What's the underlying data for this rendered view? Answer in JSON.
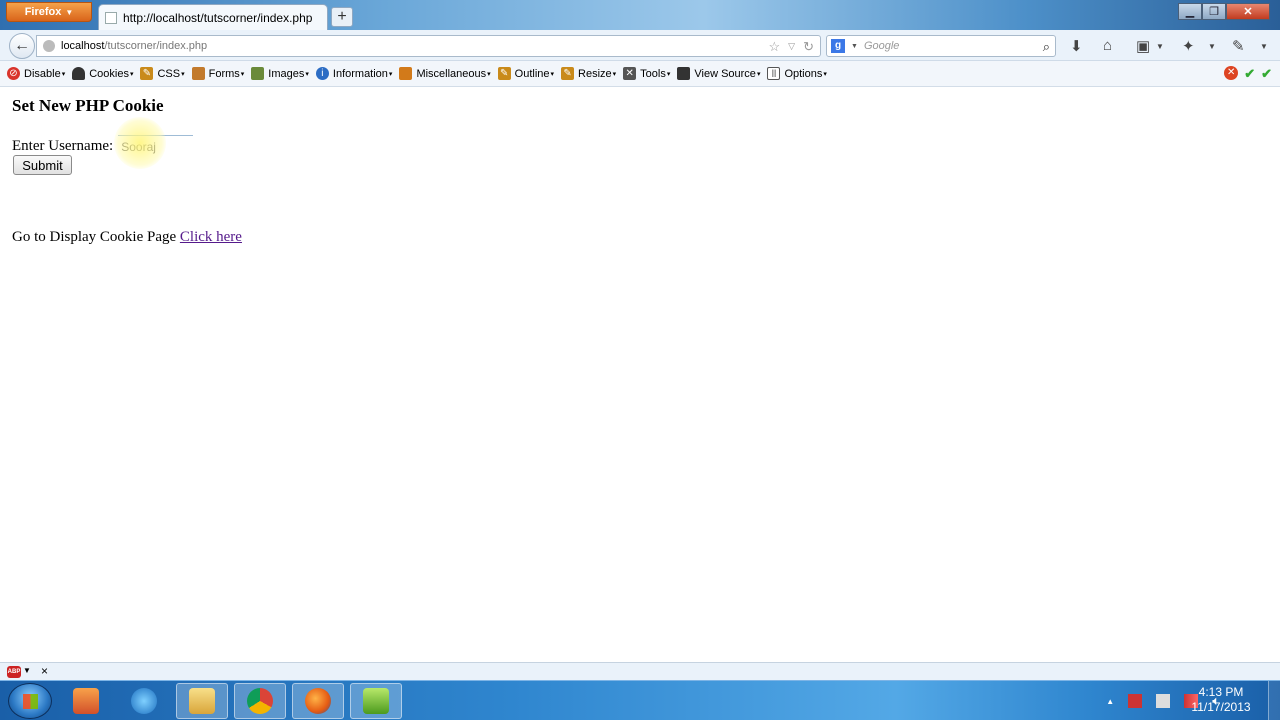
{
  "browser": {
    "app_button": "Firefox",
    "tab_title": "http://localhost/tutscorner/index.php",
    "new_tab": "+",
    "url_host": "localhost",
    "url_path": "/tutscorner/index.php",
    "search_placeholder": "Google"
  },
  "devtoolbar": {
    "items": [
      {
        "label": "Disable",
        "icon": "disable-icon",
        "color": "#d9342b"
      },
      {
        "label": "Cookies",
        "icon": "cookie-icon",
        "color": "#333333"
      },
      {
        "label": "CSS",
        "icon": "pencil-icon",
        "color": "#c98a1a"
      },
      {
        "label": "Forms",
        "icon": "clipboard-icon",
        "color": "#c27a2c"
      },
      {
        "label": "Images",
        "icon": "image-icon",
        "color": "#6a8a3a"
      },
      {
        "label": "Information",
        "icon": "info-icon",
        "color": "#2b6cc4"
      },
      {
        "label": "Miscellaneous",
        "icon": "book-icon",
        "color": "#d27a1a"
      },
      {
        "label": "Outline",
        "icon": "pencil-icon",
        "color": "#c98a1a"
      },
      {
        "label": "Resize",
        "icon": "ruler-icon",
        "color": "#c98a1a"
      },
      {
        "label": "Tools",
        "icon": "tools-icon",
        "color": "#555555"
      },
      {
        "label": "View Source",
        "icon": "monitor-icon",
        "color": "#333333"
      },
      {
        "label": "Options",
        "icon": "options-icon",
        "color": "#555555"
      }
    ]
  },
  "page": {
    "title": "Set New PHP Cookie",
    "username_label": "Enter Username:",
    "username_value": "Sooraj",
    "submit_label": "Submit",
    "display_text": "Go to Display Cookie Page",
    "display_link": "Click here"
  },
  "addonbar": {
    "abp_label": "ABP",
    "close": "×"
  },
  "taskbar": {
    "time": "4:13 PM",
    "date": "11/17/2013"
  }
}
